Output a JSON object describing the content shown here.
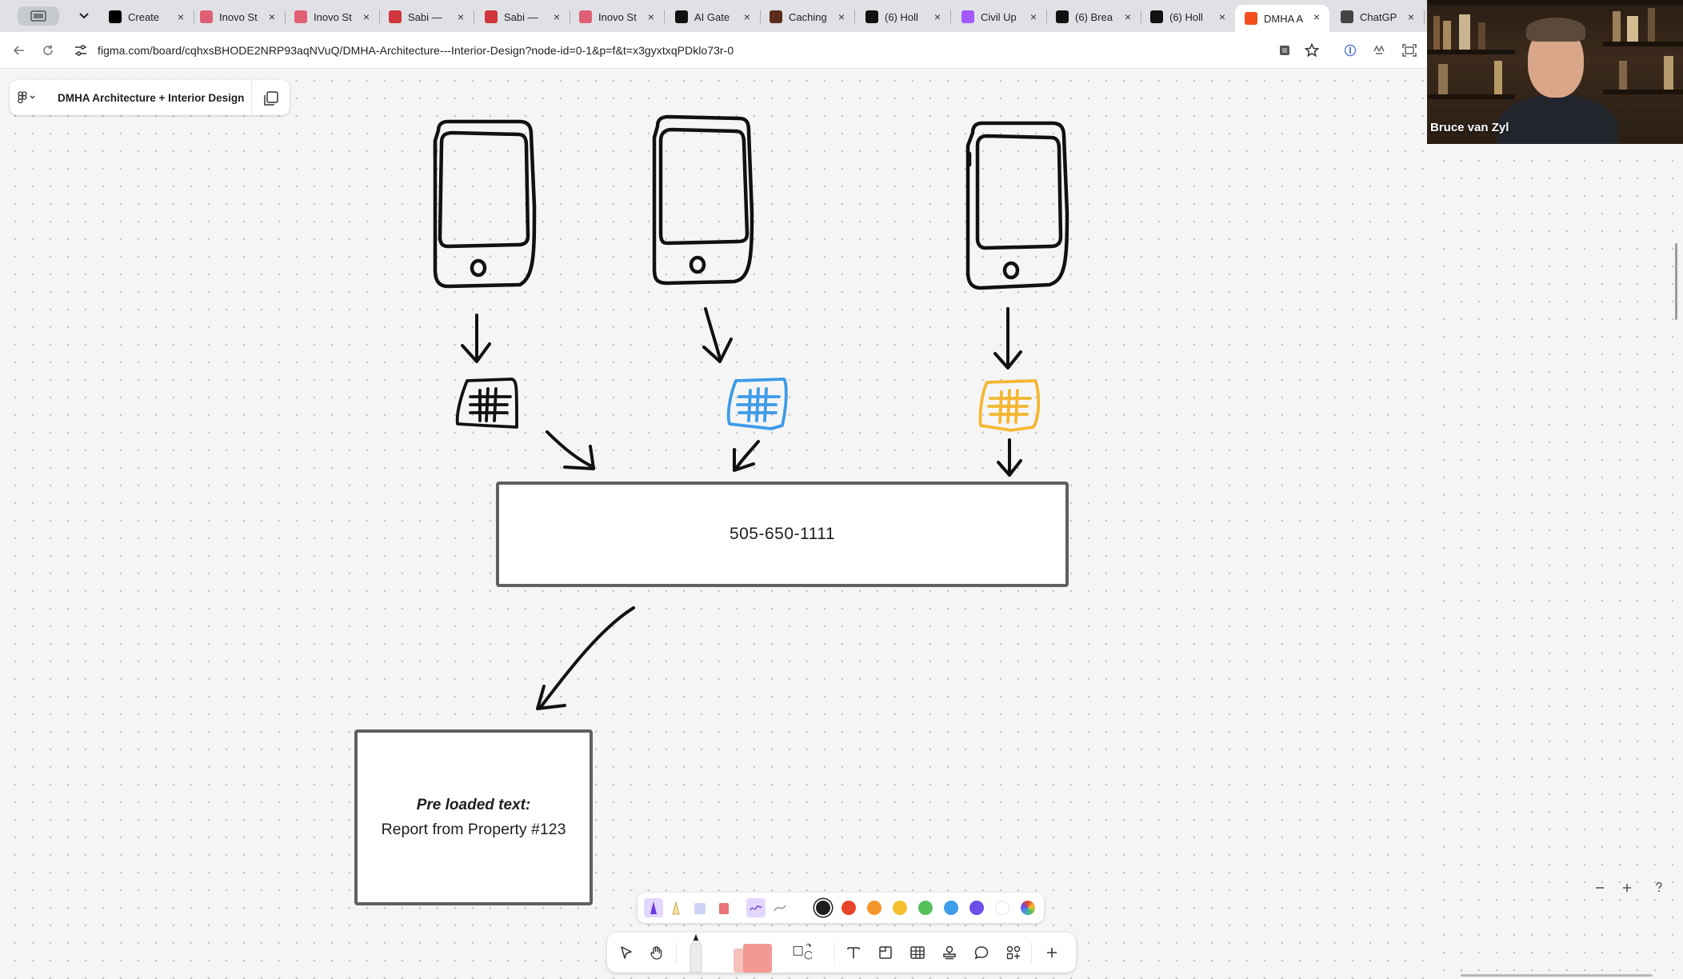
{
  "browser": {
    "tabs": [
      {
        "label": "Create",
        "favicon_color": "#000000"
      },
      {
        "label": "Inovo St",
        "favicon_color": "#e05f74"
      },
      {
        "label": "Inovo St",
        "favicon_color": "#e05f74"
      },
      {
        "label": "Sabi — ",
        "favicon_color": "#d1363f"
      },
      {
        "label": "Sabi — ",
        "favicon_color": "#d1363f"
      },
      {
        "label": "Inovo St",
        "favicon_color": "#e05f74"
      },
      {
        "label": "AI Gate",
        "favicon_color": "#111111"
      },
      {
        "label": "Caching",
        "favicon_color": "#5a2d1c"
      },
      {
        "label": "(6) Holl",
        "favicon_color": "#111111"
      },
      {
        "label": "Civil Up",
        "favicon_color": "#a259ff"
      },
      {
        "label": "(6) Brea",
        "favicon_color": "#111111"
      },
      {
        "label": "(6) Holl",
        "favicon_color": "#111111"
      },
      {
        "label": "DMHA A",
        "favicon_color": "#f24e1e"
      },
      {
        "label": "ChatGP",
        "favicon_color": "#444444"
      }
    ],
    "active_tab_index": 12,
    "url": "figma.com/board/cqhxsBHODE2NRP93aqNVuQ/DMHA-Architecture---Interior-Design?node-id=0-1&p=f&t=x3gyxtxqPDklo73r-0"
  },
  "figma": {
    "file_name": "DMHA Architecture + Interior Design",
    "phone_number_box": "505-650-1111",
    "report_box": {
      "title": "Pre loaded text:",
      "body": "Report from Property #123"
    },
    "sticker_colors": [
      "#111111",
      "#3e9be8",
      "#f5b731"
    ],
    "palette_colors": [
      "#1e1e1e",
      "#e8452c",
      "#f5962b",
      "#f5c02e",
      "#56c15b",
      "#3f9ce8",
      "#6e4ee8",
      "#ffffff"
    ]
  },
  "video": {
    "participant_name": "Bruce van Zyl"
  }
}
